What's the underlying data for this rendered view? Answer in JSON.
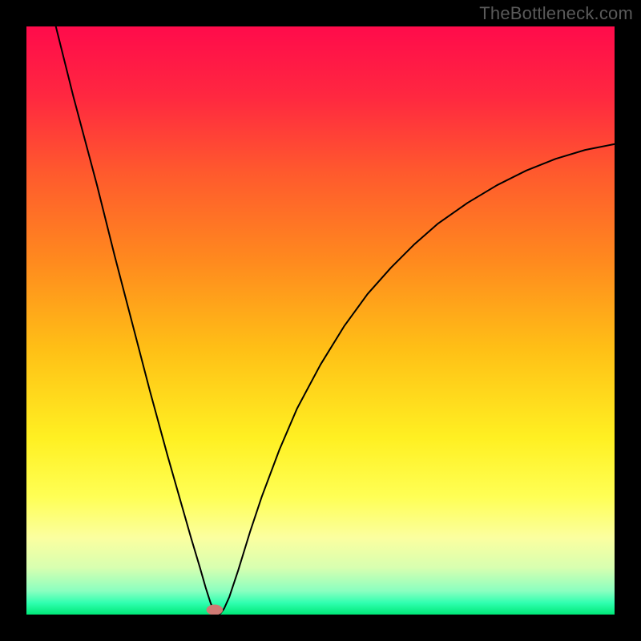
{
  "watermark": "TheBottleneck.com",
  "chart_data": {
    "type": "line",
    "title": "",
    "xlabel": "",
    "ylabel": "",
    "xlim": [
      0,
      100
    ],
    "ylim": [
      0,
      100
    ],
    "gradient_stops": [
      {
        "offset": 0,
        "color": "#ff0b4b"
      },
      {
        "offset": 12,
        "color": "#ff2840"
      },
      {
        "offset": 25,
        "color": "#ff5a2d"
      },
      {
        "offset": 40,
        "color": "#ff8a1e"
      },
      {
        "offset": 55,
        "color": "#ffc016"
      },
      {
        "offset": 70,
        "color": "#fff022"
      },
      {
        "offset": 80,
        "color": "#ffff55"
      },
      {
        "offset": 87,
        "color": "#fbffa0"
      },
      {
        "offset": 92,
        "color": "#d8ffb0"
      },
      {
        "offset": 96,
        "color": "#8affc0"
      },
      {
        "offset": 98,
        "color": "#30ffb0"
      },
      {
        "offset": 100,
        "color": "#00e878"
      }
    ],
    "curve": [
      {
        "x": 5.0,
        "y": 100.0
      },
      {
        "x": 6.0,
        "y": 96.0
      },
      {
        "x": 8.0,
        "y": 88.0
      },
      {
        "x": 10.0,
        "y": 80.5
      },
      {
        "x": 12.0,
        "y": 73.0
      },
      {
        "x": 15.0,
        "y": 61.0
      },
      {
        "x": 18.0,
        "y": 49.5
      },
      {
        "x": 21.0,
        "y": 38.0
      },
      {
        "x": 24.0,
        "y": 27.0
      },
      {
        "x": 26.0,
        "y": 20.0
      },
      {
        "x": 28.0,
        "y": 13.0
      },
      {
        "x": 29.5,
        "y": 8.0
      },
      {
        "x": 30.5,
        "y": 4.5
      },
      {
        "x": 31.3,
        "y": 2.0
      },
      {
        "x": 31.8,
        "y": 0.8
      },
      {
        "x": 32.2,
        "y": 0.2
      },
      {
        "x": 32.6,
        "y": 0.0
      },
      {
        "x": 33.0,
        "y": 0.2
      },
      {
        "x": 33.6,
        "y": 1.0
      },
      {
        "x": 34.5,
        "y": 3.0
      },
      {
        "x": 36.0,
        "y": 7.5
      },
      {
        "x": 38.0,
        "y": 14.0
      },
      {
        "x": 40.0,
        "y": 20.0
      },
      {
        "x": 43.0,
        "y": 28.0
      },
      {
        "x": 46.0,
        "y": 35.0
      },
      {
        "x": 50.0,
        "y": 42.5
      },
      {
        "x": 54.0,
        "y": 49.0
      },
      {
        "x": 58.0,
        "y": 54.5
      },
      {
        "x": 62.0,
        "y": 59.0
      },
      {
        "x": 66.0,
        "y": 63.0
      },
      {
        "x": 70.0,
        "y": 66.5
      },
      {
        "x": 75.0,
        "y": 70.0
      },
      {
        "x": 80.0,
        "y": 73.0
      },
      {
        "x": 85.0,
        "y": 75.5
      },
      {
        "x": 90.0,
        "y": 77.5
      },
      {
        "x": 95.0,
        "y": 79.0
      },
      {
        "x": 100.0,
        "y": 80.0
      }
    ],
    "marker": {
      "x": 32.0,
      "y": 0.8,
      "rx": 1.4,
      "ry": 0.9,
      "color": "#d07a74"
    }
  }
}
